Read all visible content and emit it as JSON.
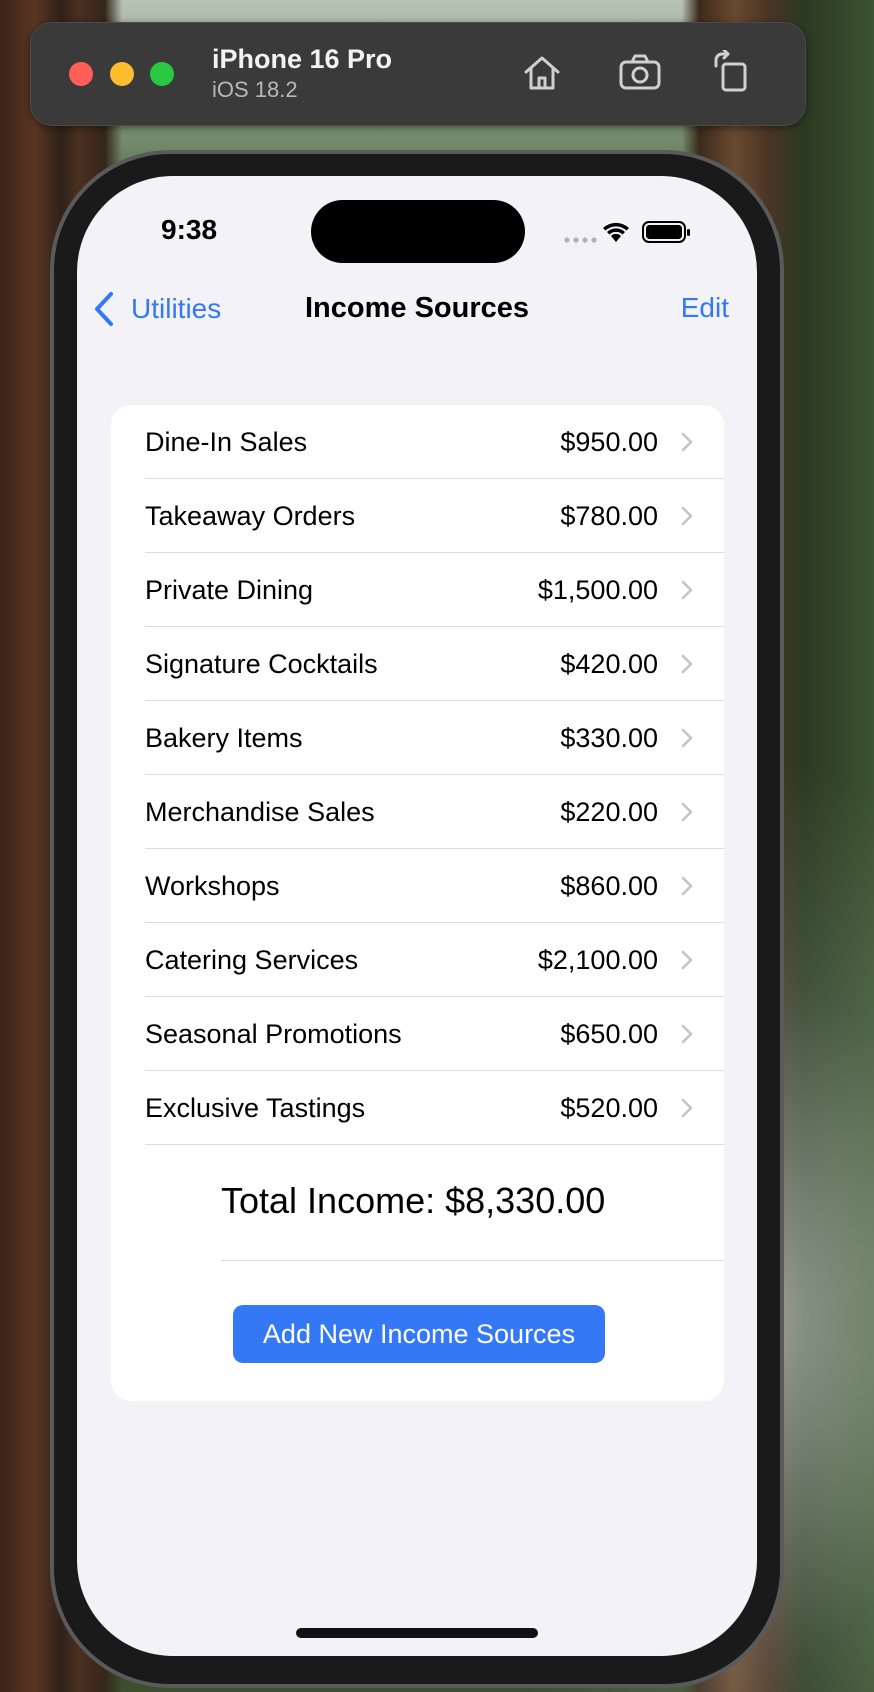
{
  "simulator": {
    "device_name": "iPhone 16 Pro",
    "os_version": "iOS 18.2",
    "toolbar_icons": [
      "home-icon",
      "screenshot-icon",
      "rotate-icon"
    ]
  },
  "status_bar": {
    "time": "9:38",
    "icons": [
      "cellular-icon",
      "wifi-icon",
      "battery-icon"
    ]
  },
  "nav": {
    "back_label": "Utilities",
    "title": "Income Sources",
    "edit_label": "Edit"
  },
  "income_sources": [
    {
      "name": "Dine-In Sales",
      "amount": "$950.00"
    },
    {
      "name": "Takeaway Orders",
      "amount": "$780.00"
    },
    {
      "name": "Private Dining",
      "amount": "$1,500.00"
    },
    {
      "name": "Signature Cocktails",
      "amount": "$420.00"
    },
    {
      "name": "Bakery Items",
      "amount": "$330.00"
    },
    {
      "name": "Merchandise Sales",
      "amount": "$220.00"
    },
    {
      "name": "Workshops",
      "amount": "$860.00"
    },
    {
      "name": "Catering Services",
      "amount": "$2,100.00"
    },
    {
      "name": "Seasonal Promotions",
      "amount": "$650.00"
    },
    {
      "name": "Exclusive Tastings",
      "amount": "$520.00"
    }
  ],
  "total_label": "Total Income: $8,330.00",
  "add_button_label": "Add New Income Sources",
  "colors": {
    "accent": "#3478f6",
    "background": "#f2f2f7",
    "card": "#ffffff"
  }
}
